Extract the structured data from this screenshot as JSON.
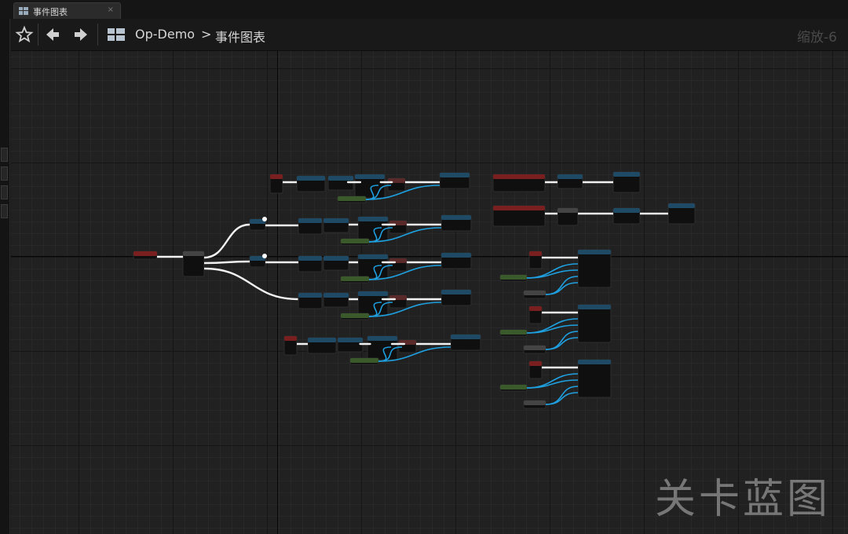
{
  "tab": {
    "label": "事件图表",
    "close": "×"
  },
  "breadcrumb": {
    "root": "Op-Demo",
    "separator": ">",
    "current": "事件图表"
  },
  "zoom": {
    "label": "缩放-6"
  },
  "watermark": {
    "label": "关卡蓝图"
  },
  "icons": {
    "favorite": "star-icon",
    "back": "arrow-left-icon",
    "forward": "arrow-right-icon",
    "blueprint": "blueprint-grid-icon"
  },
  "colors": {
    "event_header": "#7a1f1f",
    "function_header": "#1f4a66",
    "variable_header": "#3b5a2b",
    "exec_wire": "#f2f2f2",
    "data_wire": "#1ea0e0",
    "grid_bg": "#212121"
  }
}
